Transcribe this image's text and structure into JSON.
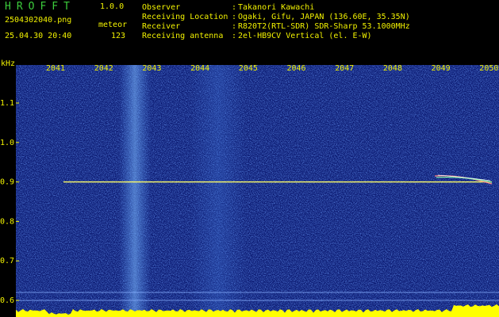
{
  "header": {
    "app_title": "HROFFT",
    "version": "1.0.0",
    "filename": "2504302040.png",
    "meteor_label": "meteor",
    "datetime": "25.04.30 20:40",
    "meteor_count": "123",
    "info": [
      {
        "label": "Observer",
        "value": "Takanori Kawachi"
      },
      {
        "label": "Receiving Location",
        "value": "Ogaki, Gifu, JAPAN (136.60E, 35.35N)"
      },
      {
        "label": "Receiver",
        "value": "R820T2(RTL-SDR) SDR-Sharp 53.1000MHz"
      },
      {
        "label": "Receiving antenna",
        "value": "2el-HB9CV Vertical (el. E-W)"
      }
    ]
  },
  "spectrogram": {
    "y_unit": "kHz",
    "y_ticks": [
      "1.1",
      "1.0",
      "0.9",
      "0.8",
      "0.7",
      "0.6"
    ],
    "x_ticks": [
      "2041",
      "2042",
      "2043",
      "2044",
      "2045",
      "2046",
      "2047",
      "2048",
      "2049",
      "2050"
    ],
    "carrier_khz": 0.9,
    "colors": {
      "background": "#0a1870",
      "carrier": "#ffff66",
      "bottom_bar": "#ffff00",
      "label": "#f2f200"
    }
  }
}
